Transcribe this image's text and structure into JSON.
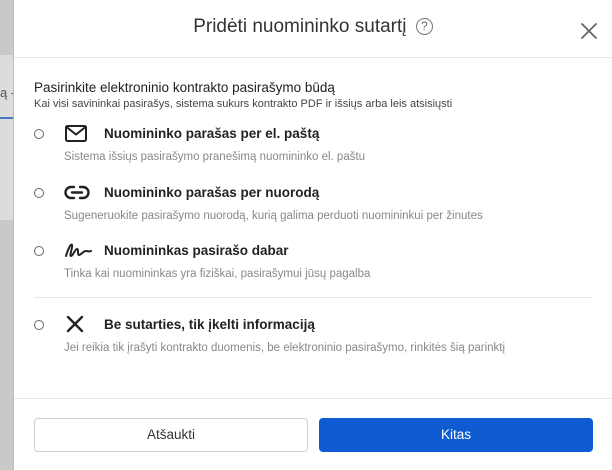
{
  "backdrop": {
    "fragment": "ą -"
  },
  "dialog": {
    "title": "Pridėti nuomininko sutartį",
    "help_icon_glyph": "?",
    "section_title": "Pasirinkite elektroninio kontrakto pasirašymo būdą",
    "section_subtitle": "Kai visi savininkai pasirašys, sistema sukurs kontrakto PDF ir išsiųs arba leis atsisiųsti",
    "options": [
      {
        "icon": "envelope-icon",
        "label": "Nuomininko parašas per el. paštą",
        "description": "Sistema išsiųs pasirašymo pranešimą nuomininko el. paštu",
        "selected": false
      },
      {
        "icon": "link-icon",
        "label": "Nuomininko parašas per nuorodą",
        "description": "Sugeneruokite pasirašymo nuorodą, kurią galima perduoti nuomininkui per žinutes",
        "selected": false
      },
      {
        "icon": "signature-icon",
        "label": "Nuomininkas pasirašo dabar",
        "description": "Tinka kai nuomininkas yra fiziškai, pasirašymui jūsų pagalba",
        "selected": false
      },
      {
        "icon": "x-icon",
        "label": "Be sutarties, tik įkelti informaciją",
        "description": "Jei reikia tik įrašyti kontrakto duomenis, be elektroninio pasirašymo, rinkitės šią parinktį",
        "selected": false
      }
    ],
    "buttons": {
      "cancel": "Atšaukti",
      "next": "Kitas"
    }
  },
  "colors": {
    "primary": "#0f5bd1",
    "backdrop": "#c9c9c9",
    "muted_text": "#888888"
  }
}
